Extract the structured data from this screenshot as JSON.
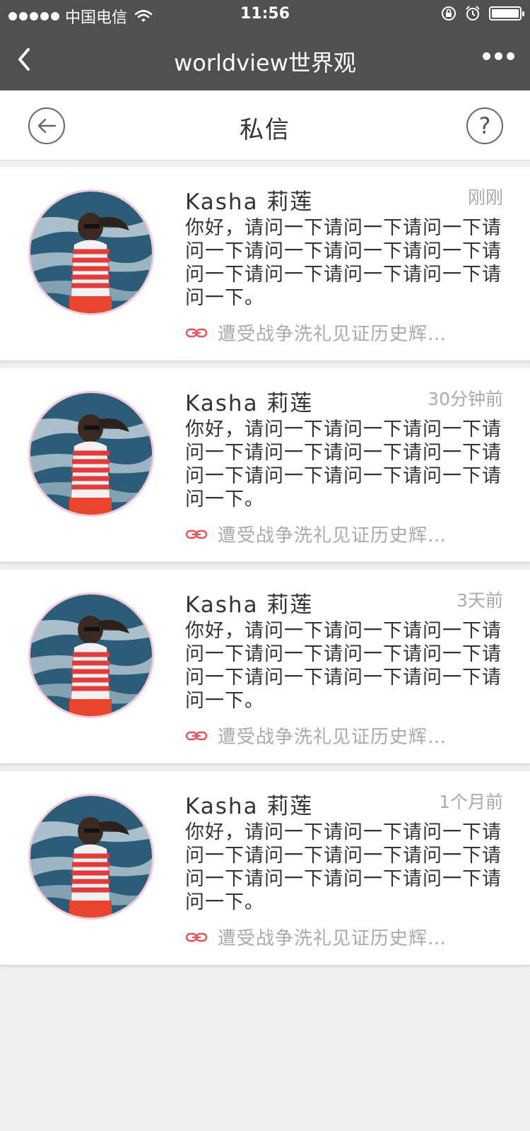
{
  "status_bar": {
    "carrier": "中国电信",
    "time": "11:56"
  },
  "title_bar": {
    "title": "worldview世界观"
  },
  "header": {
    "title": "私信",
    "help_symbol": "?"
  },
  "messages": [
    {
      "name": "Kasha  莉莲",
      "time": "刚刚",
      "text": "你好，请问一下请问一下请问一下请问一下请问一下请问一下请问一下请问一下请问一下请问一下请问一下请问一下。",
      "link": "遭受战争洗礼见证历史辉…"
    },
    {
      "name": "Kasha  莉莲",
      "time": "30分钟前",
      "text": "你好，请问一下请问一下请问一下请问一下请问一下请问一下请问一下请问一下请问一下请问一下请问一下请问一下。",
      "link": "遭受战争洗礼见证历史辉…"
    },
    {
      "name": "Kasha  莉莲",
      "time": "3天前",
      "text": "你好，请问一下请问一下请问一下请问一下请问一下请问一下请问一下请问一下请问一下请问一下请问一下请问一下。",
      "link": "遭受战争洗礼见证历史辉…"
    },
    {
      "name": "Kasha  莉莲",
      "time": "1个月前",
      "text": "你好，请问一下请问一下请问一下请问一下请问一下请问一下请问一下请问一下请问一下请问一下请问一下请问一下。",
      "link": "遭受战争洗礼见证历史辉…"
    }
  ],
  "colors": {
    "bar_background": "#505050",
    "link_icon": "#e9505a",
    "avatar_border": "#f4c6d6"
  }
}
